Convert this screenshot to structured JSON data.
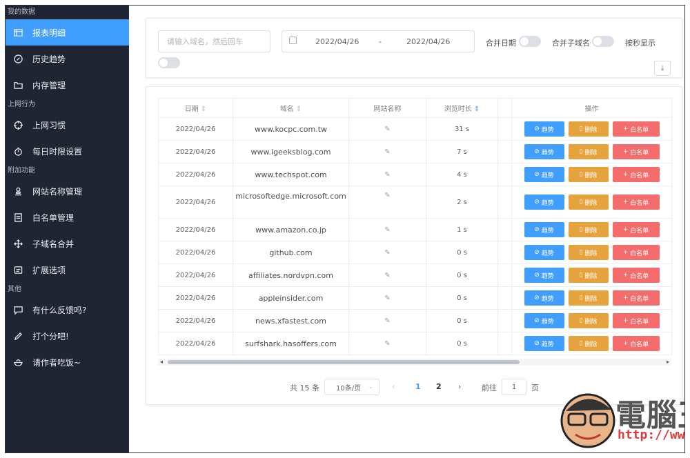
{
  "sidebar": {
    "groups": [
      {
        "label": "我的数据",
        "items": [
          {
            "label": "报表明细",
            "icon": "table-icon",
            "active": true
          },
          {
            "label": "历史趋势",
            "icon": "compass-icon"
          },
          {
            "label": "内存管理",
            "icon": "folder-icon"
          }
        ]
      },
      {
        "label": "上网行为",
        "items": [
          {
            "label": "上网习惯",
            "icon": "crosshair-icon"
          },
          {
            "label": "每日时限设置",
            "icon": "stopwatch-icon"
          }
        ]
      },
      {
        "label": "附加功能",
        "items": [
          {
            "label": "网站名称管理",
            "icon": "stamp-icon"
          },
          {
            "label": "白名单管理",
            "icon": "document-icon"
          },
          {
            "label": "子域名合并",
            "icon": "move-icon"
          },
          {
            "label": "扩展选项",
            "icon": "extension-icon"
          }
        ]
      },
      {
        "label": "其他",
        "items": [
          {
            "label": "有什么反馈吗?",
            "icon": "chat-icon"
          },
          {
            "label": "打个分吧!",
            "icon": "pen-icon"
          },
          {
            "label": "请作者吃饭~",
            "icon": "bowl-icon"
          }
        ]
      }
    ]
  },
  "filter": {
    "search_placeholder": "请输入域名，然后回车",
    "date_start": "2022/04/26",
    "date_sep": "-",
    "date_end": "2022/04/26",
    "merge_date_label": "合并日期",
    "merge_subdomain_label": "合并子域名",
    "by_seconds_label": "按秒显示"
  },
  "table": {
    "headers": {
      "date": "日期",
      "domain": "域名",
      "site_name": "网站名称",
      "duration": "浏览时长",
      "ops": "操作"
    },
    "action_labels": {
      "trend": "趋势",
      "delete": "删除",
      "whitelist": "白名单"
    },
    "rows": [
      {
        "date": "2022/04/26",
        "domain": "www.kocpc.com.tw",
        "duration": "31 s"
      },
      {
        "date": "2022/04/26",
        "domain": "www.igeeksblog.com",
        "duration": "7 s"
      },
      {
        "date": "2022/04/26",
        "domain": "www.techspot.com",
        "duration": "4 s"
      },
      {
        "date": "2022/04/26",
        "domain": "microsoftedge.microsoft.com",
        "duration": "2 s"
      },
      {
        "date": "2022/04/26",
        "domain": "www.amazon.co.jp",
        "duration": "1 s"
      },
      {
        "date": "2022/04/26",
        "domain": "github.com",
        "duration": "0 s"
      },
      {
        "date": "2022/04/26",
        "domain": "affiliates.nordvpn.com",
        "duration": "0 s"
      },
      {
        "date": "2022/04/26",
        "domain": "appleinsider.com",
        "duration": "0 s"
      },
      {
        "date": "2022/04/26",
        "domain": "news.xfastest.com",
        "duration": "0 s"
      },
      {
        "date": "2022/04/26",
        "domain": "surfshark.hasoffers.com",
        "duration": "0 s"
      }
    ]
  },
  "pagination": {
    "total_text": "共 15 条",
    "page_size": "10条/页",
    "pages": [
      "1",
      "2"
    ],
    "goto_label": "前往",
    "goto_value": "1",
    "page_unit": "页"
  },
  "watermark": {
    "brand": "電腦王阿達",
    "url": "http://www.kocpc.com.tw"
  },
  "colors": {
    "sidebar_bg": "#1f2533",
    "accent": "#409eff",
    "orange": "#e6a23c",
    "red": "#f56c6c"
  }
}
